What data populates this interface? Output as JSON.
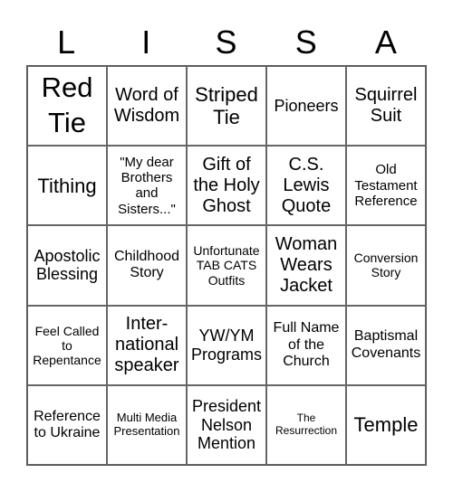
{
  "header": {
    "letters": [
      "L",
      "I",
      "S",
      "S",
      "A"
    ]
  },
  "cells": [
    [
      "Red\nTie",
      "Word of\nWisdom",
      "Striped\nTie",
      "Pioneers",
      "Squirrel\nSuit"
    ],
    [
      "Tithing",
      "\"My dear\nBrothers\nand\nSisters...\"",
      "Gift of\nthe Holy\nGhost",
      "C.S.\nLewis\nQuote",
      "Old\nTestament\nReference"
    ],
    [
      "Apostolic\nBlessing",
      "Childhood\nStory",
      "Unfortunate\nTAB CATS\nOutfits",
      "Woman\nWears\nJacket",
      "Conversion\nStory"
    ],
    [
      "Feel Called\nto\nRepentance",
      "Inter-\nnational\nspeaker",
      "YW/YM\nPrograms",
      "Full Name\nof the\nChurch",
      "Baptismal\nCovenants"
    ],
    [
      "Reference\nto Ukraine",
      "Multi Media\nPresentation",
      "President\nNelson\nMention",
      "The\nResurrection",
      "Temple"
    ]
  ]
}
